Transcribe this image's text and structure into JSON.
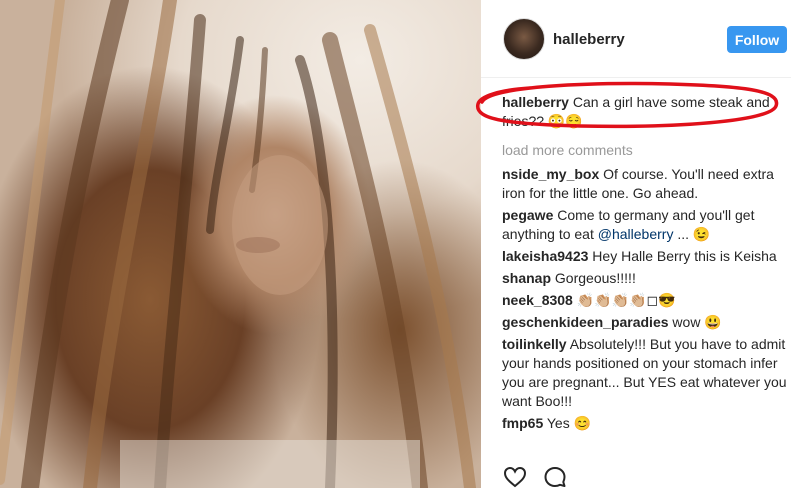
{
  "post": {
    "image_description_icon": "portrait-photo"
  },
  "header": {
    "username": "halleberry",
    "follow_label": "Follow"
  },
  "caption": {
    "user": "halleberry",
    "text": "Can a girl have some steak and fries?? 😳😌"
  },
  "load_more": "load more comments",
  "comments": [
    {
      "user": "nside_my_box",
      "text": "Of course. You'll need extra iron for the little one. Go ahead."
    },
    {
      "user": "pegawe",
      "text_before": "Come to germany and you'll get anything to eat ",
      "mention": "@halleberry",
      "text_after": " ... 😉"
    },
    {
      "user": "lakeisha9423",
      "text": "Hey Halle Berry this is Keisha"
    },
    {
      "user": "shanap",
      "text": "Gorgeous!!!!!"
    },
    {
      "user": "neek_8308",
      "text": "👏🏼👏🏼👏🏼👏🏼◻😎"
    },
    {
      "user": "geschenkideen_paradies",
      "text": "wow 😃"
    },
    {
      "user": "toilinkelly",
      "text": "Absolutely!!! But you have to admit your hands positioned on your stomach infer you are pregnant... But YES eat whatever you want Boo!!!"
    },
    {
      "user": "fmp65",
      "text": "Yes 😊"
    }
  ],
  "actions": {
    "like_icon": "heart-icon",
    "comment_icon": "comment-bubble-icon"
  },
  "colors": {
    "follow_button": "#3897f0",
    "highlight_circle": "#e0101a",
    "mention": "#003569"
  }
}
